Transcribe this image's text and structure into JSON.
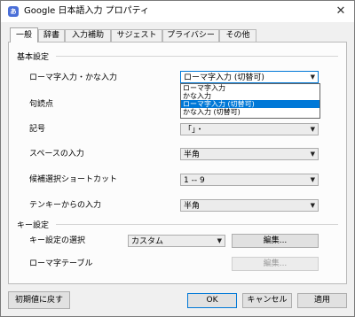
{
  "window": {
    "title": "Google 日本語入力 プロパティ",
    "close_glyph": "✕",
    "icon": "google-ime-icon",
    "icon_glyph": "あ"
  },
  "tabs": [
    {
      "label": "一般"
    },
    {
      "label": "辞書"
    },
    {
      "label": "入力補助"
    },
    {
      "label": "サジェスト"
    },
    {
      "label": "プライバシー"
    },
    {
      "label": "その他"
    }
  ],
  "basic": {
    "group_title": "基本設定",
    "romaji_kana": {
      "label": "ローマ字入力・かな入力",
      "value": "ローマ字入力 (切替可)"
    },
    "dropdown_options": [
      "ローマ字入力",
      "かな入力",
      "ローマ字入力 (切替可)",
      "かな入力 (切替可)"
    ],
    "punctuation": {
      "label": "句読点"
    },
    "symbols": {
      "label": "記号",
      "value": "「」・"
    },
    "space": {
      "label": "スペースの入力",
      "value": "半角"
    },
    "shortcut": {
      "label": "候補選択ショートカット",
      "value": "1 -- 9"
    },
    "tenkey": {
      "label": "テンキーからの入力",
      "value": "半角"
    }
  },
  "keys": {
    "group_title": "キー設定",
    "keymap": {
      "label": "キー設定の選択",
      "value": "カスタム",
      "edit": "編集..."
    },
    "romaji_table": {
      "label": "ローマ字テーブル",
      "edit": "編集..."
    }
  },
  "footer": {
    "reset": "初期値に戻す",
    "ok": "OK",
    "cancel": "キャンセル",
    "apply": "適用"
  }
}
